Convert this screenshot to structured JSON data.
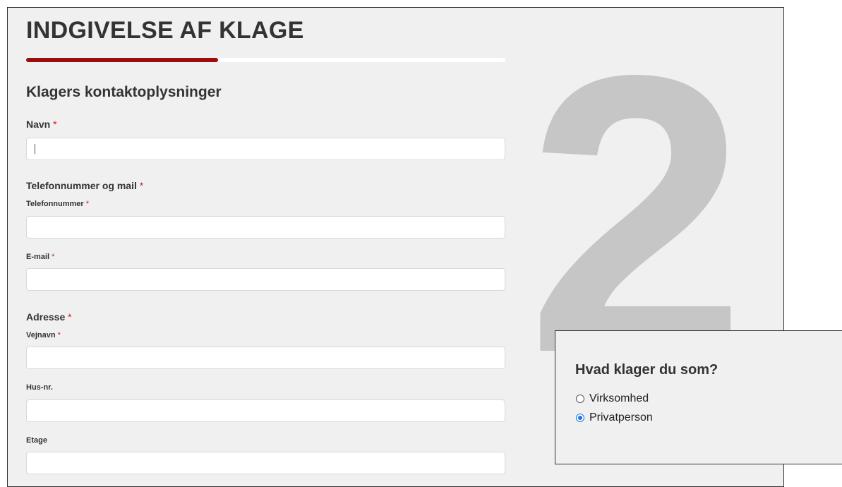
{
  "form": {
    "title": "INDGIVELSE AF KLAGE",
    "step_number": "2",
    "progress_fraction": 0.4,
    "progress_color": "#9b0c0c",
    "section_title": "Klagers kontaktoplysninger",
    "required_marker": "*",
    "fields": {
      "navn": {
        "label": "Navn",
        "value": ""
      },
      "contact_group": {
        "label": "Telefonnummer og mail"
      },
      "telefon": {
        "label": "Telefonnummer",
        "value": ""
      },
      "email": {
        "label": "E-mail",
        "value": ""
      },
      "address_group": {
        "label": "Adresse"
      },
      "vejnavn": {
        "label": "Vejnavn",
        "value": ""
      },
      "husnr": {
        "label": "Hus-nr.",
        "value": ""
      },
      "etage": {
        "label": "Etage",
        "value": ""
      }
    }
  },
  "popup": {
    "question": "Hvad klager du som?",
    "options": [
      {
        "label": "Virksomhed",
        "selected": false
      },
      {
        "label": "Privatperson",
        "selected": true
      }
    ],
    "accent_color": "#1a73e8"
  }
}
